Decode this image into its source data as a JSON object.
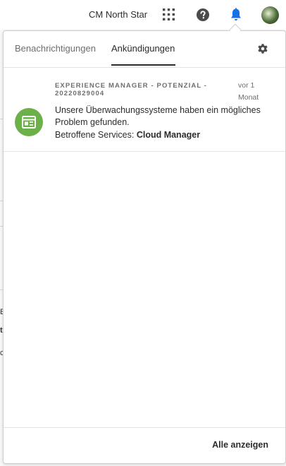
{
  "header": {
    "org_name": "CM North Star",
    "icons": [
      "apps-grid-icon",
      "help-icon",
      "bell-icon",
      "avatar"
    ],
    "accent_color": "#1473e6"
  },
  "background": {
    "fragments": [
      "E",
      "t",
      "c"
    ]
  },
  "panel": {
    "tabs": [
      {
        "label": "Benachrichtigungen",
        "active": false
      },
      {
        "label": "Ankündigungen",
        "active": true
      }
    ],
    "settings_icon": "gear-icon",
    "notification": {
      "icon": "web-page-icon",
      "icon_color": "#6cb04a",
      "title": "EXPERIENCE MANAGER - POTENZIAL - 20220829004",
      "time": "vor 1 Monat",
      "body": "Unsere Überwachungssysteme haben ein mögliches Problem gefunden.",
      "services_label": "Betroffene Services:",
      "services_value": "Cloud Manager"
    },
    "footer": {
      "view_all_label": "Alle anzeigen"
    }
  }
}
